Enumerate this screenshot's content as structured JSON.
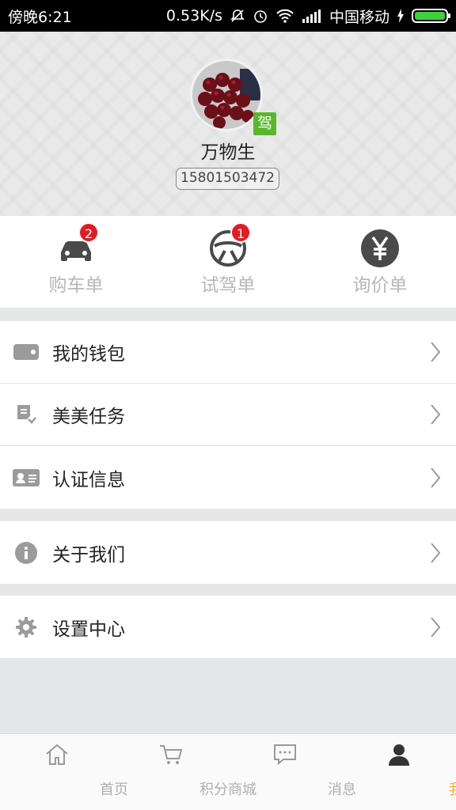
{
  "status_bar": {
    "time": "傍晚6:21",
    "speed": "0.53K/s",
    "carrier": "中国移动"
  },
  "profile": {
    "driver_badge": "驾",
    "username": "万物生",
    "phone": "15801503472"
  },
  "quick_actions": [
    {
      "label": "购车单",
      "icon": "car-icon",
      "badge": "2"
    },
    {
      "label": "试驾单",
      "icon": "steering-wheel-icon",
      "badge": "1"
    },
    {
      "label": "询价单",
      "icon": "yen-icon",
      "badge": ""
    }
  ],
  "menu": {
    "group1": [
      {
        "label": "我的钱包",
        "icon": "wallet-icon"
      },
      {
        "label": "美美任务",
        "icon": "task-icon"
      },
      {
        "label": "认证信息",
        "icon": "id-card-icon"
      }
    ],
    "group2": [
      {
        "label": "关于我们",
        "icon": "info-icon"
      }
    ],
    "group3": [
      {
        "label": "设置中心",
        "icon": "gear-icon"
      }
    ]
  },
  "tabbar": [
    {
      "label": "首页",
      "icon": "home-icon",
      "active": false
    },
    {
      "label": "积分商城",
      "icon": "cart-icon",
      "active": false
    },
    {
      "label": "消息",
      "icon": "message-icon",
      "active": false
    },
    {
      "label": "我",
      "icon": "user-icon",
      "active": true
    }
  ],
  "colors": {
    "accent": "#f5b617",
    "badge": "#e31b23",
    "driver_badge": "#57b82a",
    "battery": "#3ed13a"
  }
}
